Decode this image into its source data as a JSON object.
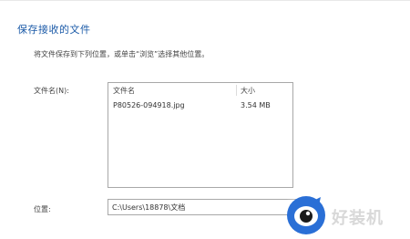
{
  "dialog": {
    "title": "保存接收的文件",
    "instruction": "将文件保存到下列位置，或单击“浏览”选择其他位置。",
    "filename_label": "文件名(N):",
    "columns": {
      "name": "文件名",
      "size": "大小"
    },
    "files": [
      {
        "name": "P80526-094918.jpg",
        "size": "3.54 MB"
      }
    ],
    "location_label": "位置:",
    "location_value": "C:\\Users\\18878\\文档"
  },
  "watermark": {
    "text": "好装机",
    "icon": "eye-logo-icon"
  }
}
